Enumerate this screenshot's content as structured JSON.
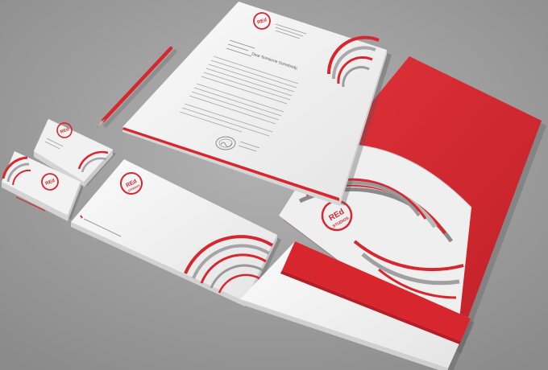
{
  "brand": {
    "logo_word": "REd",
    "logo_sub": "STUDIOS",
    "accent": "#d8262f",
    "accent_dark": "#b81d25",
    "paper": "#f2f2f2",
    "background": "#9c9c9c"
  },
  "letterhead": {
    "salutation": "Dear Someone Somebody,"
  },
  "items": [
    "pencil-icon",
    "letterhead",
    "business-card",
    "envelope",
    "presentation-folder",
    "window-envelope"
  ]
}
